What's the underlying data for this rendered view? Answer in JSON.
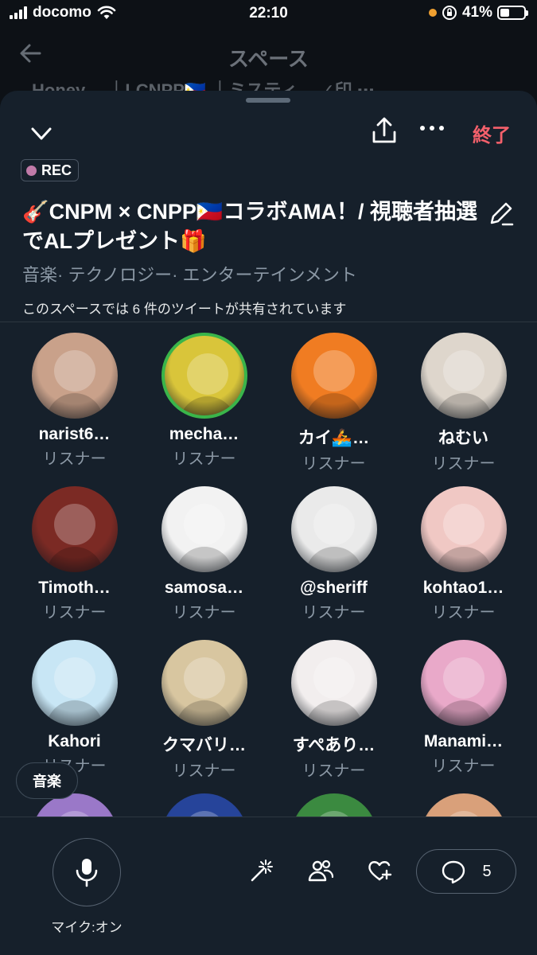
{
  "status": {
    "carrier": "docomo",
    "time": "22:10",
    "battery": "41%",
    "battery_level": 0.41
  },
  "background": {
    "title": "スペース",
    "row_text": "Honey… ｜LCNPP🇵🇭 ｜ミスティ… ✓印 ⋯"
  },
  "header": {
    "end_label": "終了"
  },
  "space": {
    "rec_label": "REC",
    "title": "🎸CNPM × CNPP🇵🇭コラボAMA！/ 視聴者抽選でALプレゼント🎁",
    "topics": "音楽· テクノロジー· エンターテインメント",
    "tweets_notice": "このスペースでは 6 件のツイートが共有されています"
  },
  "listeners": [
    {
      "name": "narist6…",
      "role": "リスナー",
      "color": "#c9a18a"
    },
    {
      "name": "mecha…",
      "role": "リスナー",
      "color": "#d9c53a"
    },
    {
      "name": "カイ🚣‍…",
      "role": "リスナー",
      "color": "#f07c22"
    },
    {
      "name": "ねむい",
      "role": "リスナー",
      "color": "#ded6cc"
    },
    {
      "name": "Timoth…",
      "role": "リスナー",
      "color": "#7b2a24"
    },
    {
      "name": "samosa…",
      "role": "リスナー",
      "color": "#f2f2f2"
    },
    {
      "name": "@sheriff",
      "role": "リスナー",
      "color": "#eaeaea"
    },
    {
      "name": "kohtao1…",
      "role": "リスナー",
      "color": "#f0c8c4"
    },
    {
      "name": "Kahori",
      "role": "リスナー",
      "color": "#c8e6f5"
    },
    {
      "name": "クマバリ…",
      "role": "リスナー",
      "color": "#d8c6a0"
    },
    {
      "name": "すぺあり…",
      "role": "リスナー",
      "color": "#f2eeee"
    },
    {
      "name": "Manami…",
      "role": "リスナー",
      "color": "#e9a9c9"
    },
    {
      "name": "",
      "role": "",
      "color": "#9a78c8"
    },
    {
      "name": "",
      "role": "",
      "color": "#26449a"
    },
    {
      "name": "",
      "role": "",
      "color": "#3b8a40"
    },
    {
      "name": "",
      "role": "",
      "color": "#d9a07a"
    }
  ],
  "music_chip": "音楽",
  "bottom": {
    "mic_label": "マイク:オン",
    "reply_count": "5"
  },
  "colors": {
    "sheet_bg": "#16202b",
    "accent_end": "#f4606b",
    "rec_dot": "#c07aa8"
  }
}
